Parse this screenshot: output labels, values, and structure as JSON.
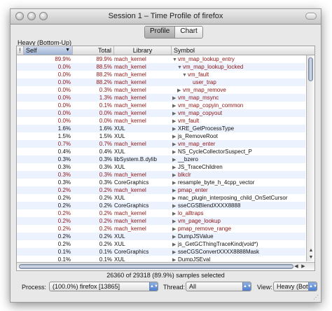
{
  "window": {
    "title": "Session 1 – Time Profile of firefox"
  },
  "tabs": [
    {
      "label": "Profile",
      "selected": true
    },
    {
      "label": "Chart",
      "selected": false
    }
  ],
  "view_label": "Heavy (Bottom-Up)",
  "table": {
    "headers": {
      "flag": "!",
      "self": "Self",
      "total": "Total",
      "library": "Library",
      "symbol": "Symbol"
    },
    "sort_indicator": "▼",
    "rows": [
      {
        "self": "89.9%",
        "total": "89.9%",
        "library": "mach_kernel",
        "symbol": "vm_map_lookup_entry",
        "indent": 0,
        "arrow": "▼",
        "red": true
      },
      {
        "self": "0.0%",
        "total": "88.5%",
        "library": "mach_kernel",
        "symbol": "vm_map_lookup_locked",
        "indent": 1,
        "arrow": "▼",
        "red": true
      },
      {
        "self": "0.0%",
        "total": "88.2%",
        "library": "mach_kernel",
        "symbol": "vm_fault",
        "indent": 2,
        "arrow": "▼",
        "red": true
      },
      {
        "self": "0.0%",
        "total": "88.2%",
        "library": "mach_kernel",
        "symbol": "user_trap",
        "indent": 3,
        "arrow": "",
        "red": true
      },
      {
        "self": "0.0%",
        "total": "0.3%",
        "library": "mach_kernel",
        "symbol": "vm_map_remove",
        "indent": 1,
        "arrow": "▶",
        "red": true
      },
      {
        "self": "0.0%",
        "total": "1.3%",
        "library": "mach_kernel",
        "symbol": "vm_map_msync",
        "indent": 0,
        "arrow": "▶",
        "red": true
      },
      {
        "self": "0.0%",
        "total": "0.1%",
        "library": "mach_kernel",
        "symbol": "vm_map_copyin_common",
        "indent": 0,
        "arrow": "▶",
        "red": true
      },
      {
        "self": "0.0%",
        "total": "0.0%",
        "library": "mach_kernel",
        "symbol": "vm_map_copyout",
        "indent": 0,
        "arrow": "▶",
        "red": true
      },
      {
        "self": "0.0%",
        "total": "0.0%",
        "library": "mach_kernel",
        "symbol": "vm_fault",
        "indent": 0,
        "arrow": "▶",
        "red": true
      },
      {
        "self": "1.6%",
        "total": "1.6%",
        "library": "XUL",
        "symbol": "XRE_GetProcessType",
        "indent": 0,
        "arrow": "▶",
        "red": false
      },
      {
        "self": "1.5%",
        "total": "1.5%",
        "library": "XUL",
        "symbol": "js_RemoveRoot",
        "indent": 0,
        "arrow": "▶",
        "red": false
      },
      {
        "self": "0.7%",
        "total": "0.7%",
        "library": "mach_kernel",
        "symbol": "vm_map_enter",
        "indent": 0,
        "arrow": "▶",
        "red": true
      },
      {
        "self": "0.4%",
        "total": "0.4%",
        "library": "XUL",
        "symbol": "NS_CycleCollectorSuspect_P",
        "indent": 0,
        "arrow": "▶",
        "red": false
      },
      {
        "self": "0.3%",
        "total": "0.3%",
        "library": "libSystem.B.dylib",
        "symbol": "__bzero",
        "indent": 0,
        "arrow": "▶",
        "red": false
      },
      {
        "self": "0.3%",
        "total": "0.3%",
        "library": "XUL",
        "symbol": "JS_TraceChildren",
        "indent": 0,
        "arrow": "▶",
        "red": false
      },
      {
        "self": "0.3%",
        "total": "0.3%",
        "library": "mach_kernel",
        "symbol": "blkclr",
        "indent": 0,
        "arrow": "▶",
        "red": true
      },
      {
        "self": "0.3%",
        "total": "0.3%",
        "library": "CoreGraphics",
        "symbol": "resample_byte_h_4cpp_vector",
        "indent": 0,
        "arrow": "▶",
        "red": false
      },
      {
        "self": "0.2%",
        "total": "0.2%",
        "library": "mach_kernel",
        "symbol": "pmap_enter",
        "indent": 0,
        "arrow": "▶",
        "red": true
      },
      {
        "self": "0.2%",
        "total": "0.2%",
        "library": "XUL",
        "symbol": "mac_plugin_interposing_child_OnSetCursor",
        "indent": 0,
        "arrow": "▶",
        "red": false
      },
      {
        "self": "0.2%",
        "total": "0.2%",
        "library": "CoreGraphics",
        "symbol": "sseCGSBlendXXXX8888",
        "indent": 0,
        "arrow": "▶",
        "red": false
      },
      {
        "self": "0.2%",
        "total": "0.2%",
        "library": "mach_kernel",
        "symbol": "lo_alltraps",
        "indent": 0,
        "arrow": "▶",
        "red": true
      },
      {
        "self": "0.2%",
        "total": "0.2%",
        "library": "mach_kernel",
        "symbol": "vm_page_lookup",
        "indent": 0,
        "arrow": "▶",
        "red": true
      },
      {
        "self": "0.2%",
        "total": "0.2%",
        "library": "mach_kernel",
        "symbol": "pmap_remove_range",
        "indent": 0,
        "arrow": "▶",
        "red": true
      },
      {
        "self": "0.2%",
        "total": "0.2%",
        "library": "XUL",
        "symbol": "DumpJSValue",
        "indent": 0,
        "arrow": "▶",
        "red": false
      },
      {
        "self": "0.2%",
        "total": "0.2%",
        "library": "XUL",
        "symbol": "js_GetGCThingTraceKind(void*)",
        "indent": 0,
        "arrow": "▶",
        "red": false
      },
      {
        "self": "0.1%",
        "total": "0.1%",
        "library": "CoreGraphics",
        "symbol": "sseCGSConvertXXXX8888Mask",
        "indent": 0,
        "arrow": "▶",
        "red": false
      },
      {
        "self": "0.1%",
        "total": "0.1%",
        "library": "XUL",
        "symbol": "DumpJSEval",
        "indent": 0,
        "arrow": "▶",
        "red": false
      },
      {
        "self": "0.1%",
        "total": "0.1%",
        "library": "mach_kernel",
        "symbol": "ml_set_interrupts_enabled",
        "indent": 0,
        "arrow": "▶",
        "red": true
      },
      {
        "self": "0.1%",
        "total": "0.1%",
        "library": "mach_kernel",
        "symbol": "phys_attribute_clear",
        "indent": 0,
        "arrow": "▶",
        "red": true
      },
      {
        "self": "0.1%",
        "total": "0.1%",
        "library": "XUL",
        "symbol": "NS_LogCtor_P",
        "indent": 0,
        "arrow": "▶",
        "red": false
      },
      {
        "self": "0.1%",
        "total": "0.1%",
        "library": "XUL",
        "symbol": "CGBlt_copyBytes",
        "indent": 0,
        "arrow": "▶",
        "red": false
      }
    ]
  },
  "status": "26360 of 29318 (89.9%) samples selected",
  "bottom_bar": {
    "process_label": "Process:",
    "process_value": "(100.0%) firefox [13865]",
    "thread_label": "Thread:",
    "thread_value": "All",
    "view_label": "View:",
    "view_value": "Heavy (Bottom-Up)"
  }
}
